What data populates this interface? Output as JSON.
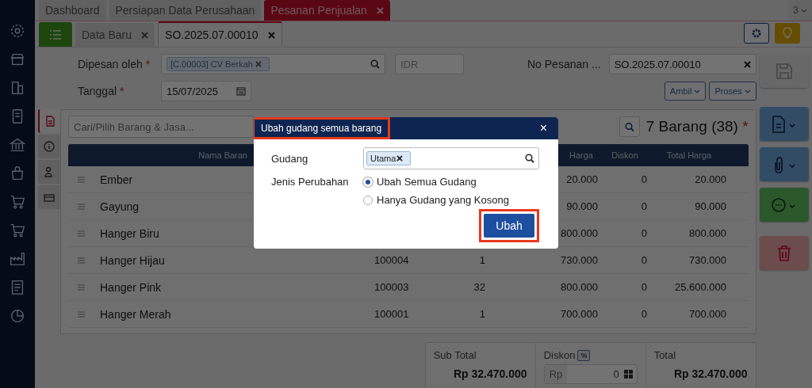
{
  "top_tabs": [
    {
      "label": "Dashboard",
      "selected": false,
      "closable": false
    },
    {
      "label": "Persiapan Data Perusahaan",
      "selected": false,
      "closable": false
    },
    {
      "label": "Pesanan Penjualan",
      "selected": true,
      "closable": true
    }
  ],
  "tab_counter": "3",
  "doc_tabs": [
    {
      "label": "Data Baru",
      "selected": false
    },
    {
      "label": "SO.2025.07.00010",
      "selected": true
    }
  ],
  "form": {
    "ordered_by": {
      "label": "Dipesan oleh",
      "required": "*",
      "value": "[C.00003] CV Berkah"
    },
    "currency": "IDR",
    "order_no": {
      "label": "No Pesanan ...",
      "value": "SO.2025.07.00010"
    },
    "date": {
      "label": "Tanggal",
      "required": "*",
      "value": "15/07/2025"
    }
  },
  "actions": [
    "Ambil",
    "Proses"
  ],
  "search": {
    "placeholder": "Cari/Pilih Barang & Jasa..."
  },
  "side_tabs": [
    {
      "kind": "document",
      "selected": true
    },
    {
      "kind": "info",
      "selected": false
    },
    {
      "kind": "person",
      "selected": false
    },
    {
      "kind": "box",
      "selected": false
    }
  ],
  "item_count": {
    "text": "7 Barang (38)",
    "required": "*"
  },
  "table": {
    "columns": [
      "Nama Baran",
      "Harga",
      "Diskon",
      "Total Harga"
    ],
    "rows": [
      {
        "name": "Ember",
        "price": "20.000",
        "discount": "0",
        "total": "20.000"
      },
      {
        "name": "Gayung",
        "price": "90.000",
        "discount": "0",
        "total": "90.000"
      },
      {
        "name": "Hanger Biru",
        "price": "800.000",
        "discount": "0",
        "total": "800.000"
      },
      {
        "name": "Hanger Hijau",
        "code": "100004",
        "qty": "1",
        "price": "730.000",
        "discount": "0",
        "total": "730.000"
      },
      {
        "name": "Hanger Pink",
        "code": "100003",
        "qty": "32",
        "price": "800.000",
        "discount": "0",
        "total": "25.600.000"
      },
      {
        "name": "Hanger Merah",
        "code": "100001",
        "qty": "1",
        "price": "700.000",
        "discount": "0",
        "total": "700.000"
      }
    ]
  },
  "totals": {
    "sub_total_label": "Sub Total",
    "sub_total": "Rp 32.470.000",
    "discount_label": "Diskon",
    "discount_toggle": "%",
    "discount_prefix": "Rp",
    "discount_value": "0",
    "total_label": "Total",
    "total": "Rp 32.470.000"
  },
  "modal": {
    "title": "Ubah gudang semua barang",
    "title_highlighted": true,
    "close": "×",
    "warehouse_label": "Gudang",
    "warehouse_tag": "Utama",
    "change_label": "Jenis Perubahan",
    "options": [
      {
        "label": "Ubah Semua Gudang",
        "selected": true
      },
      {
        "label": "Hanya Gudang yang Kosong",
        "selected": false
      }
    ],
    "submit": "Ubah",
    "submit_highlighted": true
  }
}
